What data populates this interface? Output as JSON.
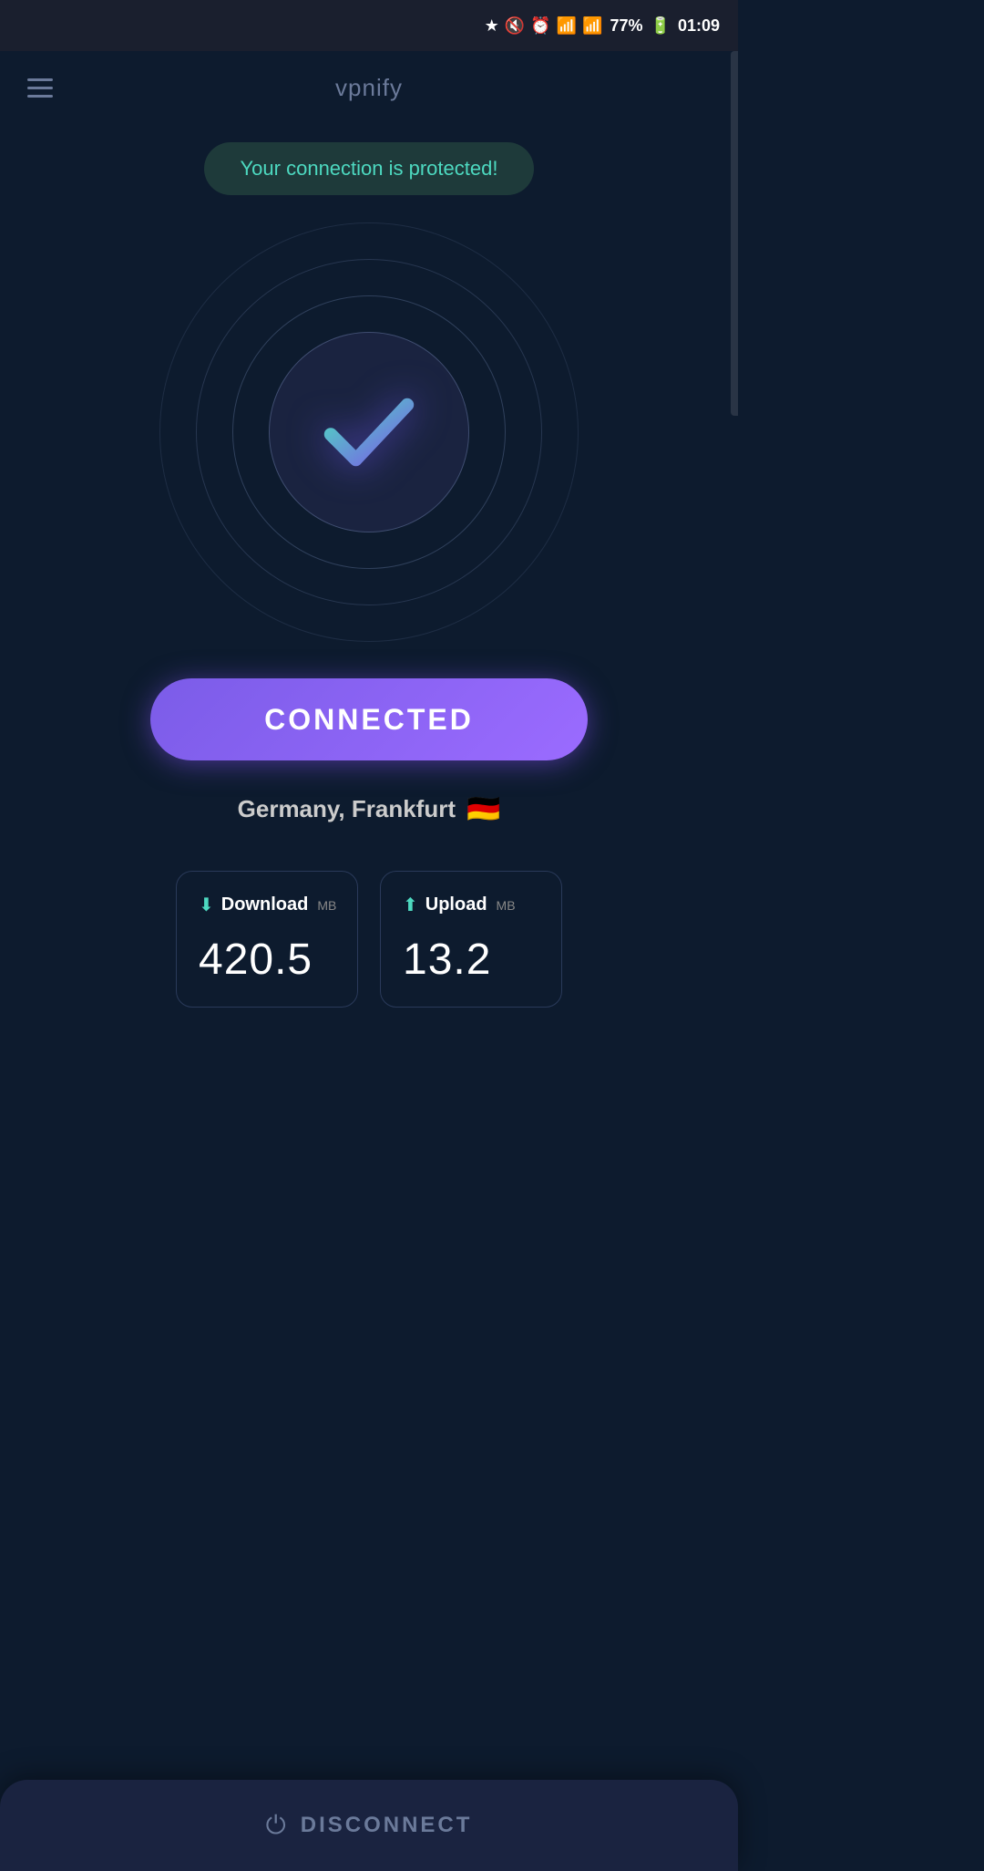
{
  "statusBar": {
    "battery": "77%",
    "time": "01:09",
    "icons": [
      "bluetooth",
      "mute",
      "alarm",
      "wifi",
      "signal"
    ]
  },
  "header": {
    "title": "vpnify",
    "menuLabel": "Menu"
  },
  "protection": {
    "message": "Your connection is protected!"
  },
  "connection": {
    "status": "CONNECTED",
    "location": "Germany, Frankfurt",
    "flag": "🇩🇪"
  },
  "stats": {
    "download": {
      "label": "Download",
      "unit": "MB",
      "value": "420.5"
    },
    "upload": {
      "label": "Upload",
      "unit": "MB",
      "value": "13.2"
    }
  },
  "disconnect": {
    "label": "DISCONNECT"
  }
}
